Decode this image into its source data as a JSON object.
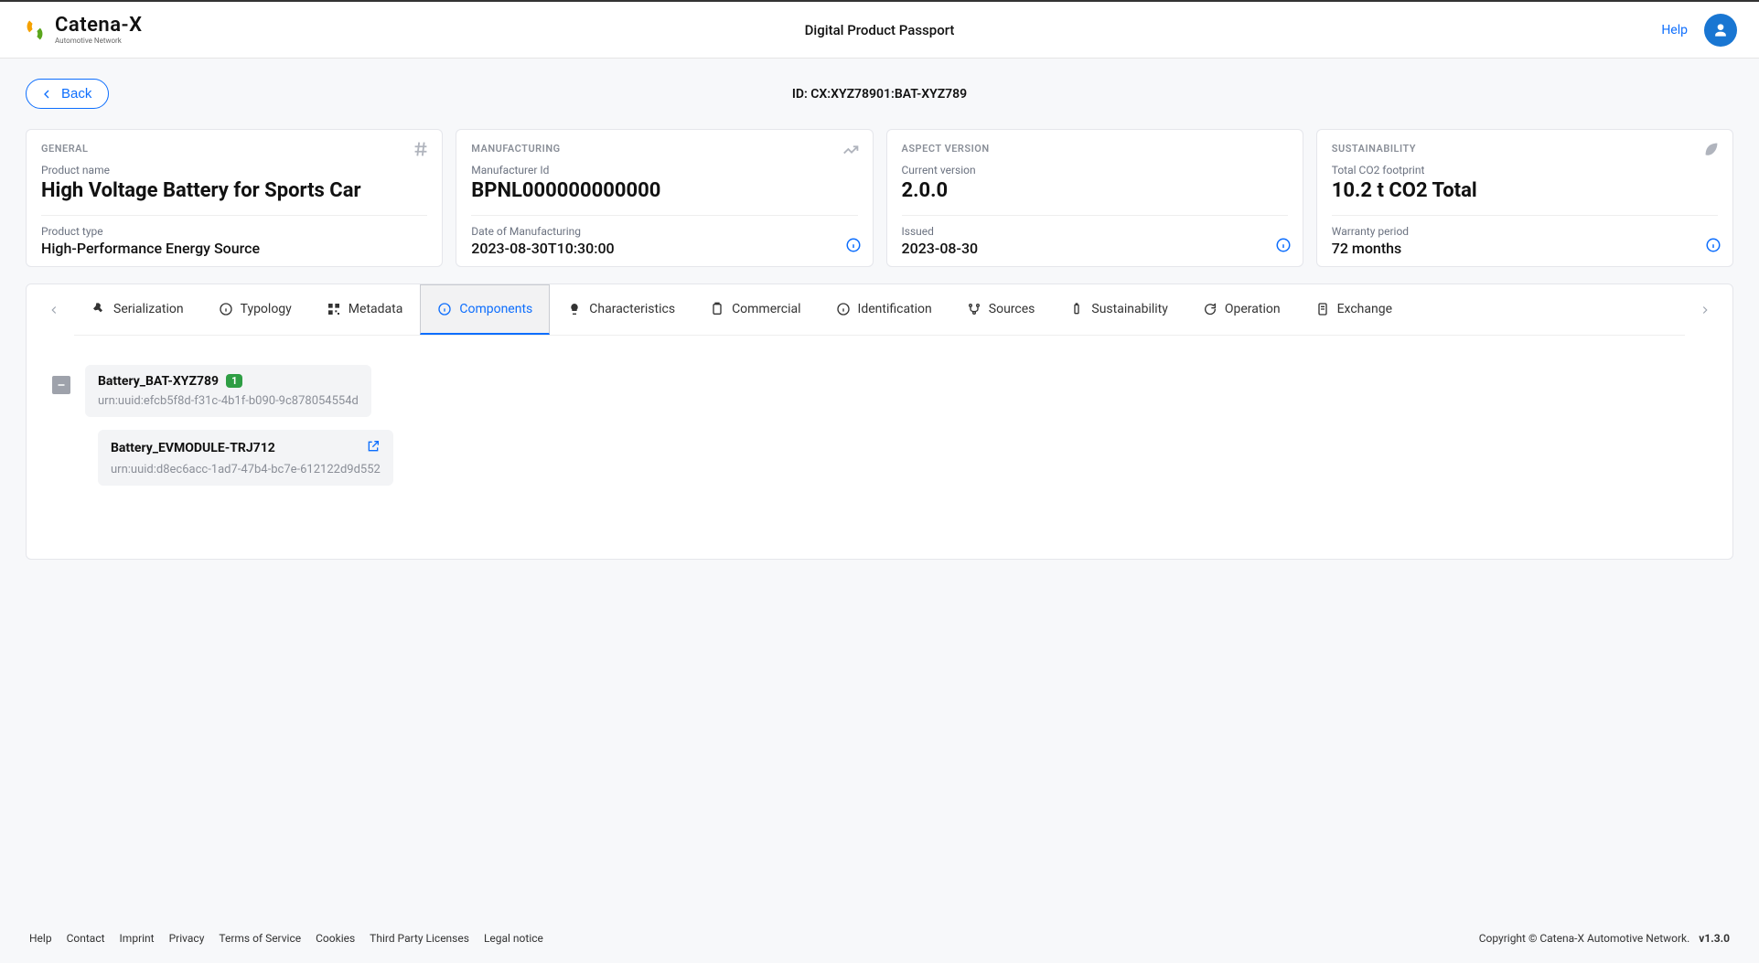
{
  "header": {
    "brand_name": "Catena-X",
    "brand_sub": "Automotive Network",
    "title": "Digital Product Passport",
    "help": "Help"
  },
  "page": {
    "back": "Back",
    "id_label": "ID: CX:XYZ78901:BAT-XYZ789"
  },
  "cards": {
    "general": {
      "category": "GENERAL",
      "name_label": "Product name",
      "name_value": "High Voltage Battery for Sports Car",
      "type_label": "Product type",
      "type_value": "High-Performance Energy Source"
    },
    "manufacturing": {
      "category": "MANUFACTURING",
      "id_label": "Manufacturer Id",
      "id_value": "BPNL000000000000",
      "date_label": "Date of Manufacturing",
      "date_value": "2023-08-30T10:30:00"
    },
    "aspect": {
      "category": "ASPECT VERSION",
      "cur_label": "Current version",
      "cur_value": "2.0.0",
      "issued_label": "Issued",
      "issued_value": "2023-08-30"
    },
    "sustainability": {
      "category": "SUSTAINABILITY",
      "co2_label": "Total CO2 footprint",
      "co2_value": "10.2 t CO2 Total",
      "warranty_label": "Warranty period",
      "warranty_value": "72 months"
    }
  },
  "tabs": [
    "Serialization",
    "Typology",
    "Metadata",
    "Components",
    "Characteristics",
    "Commercial",
    "Identification",
    "Sources",
    "Sustainability",
    "Operation",
    "Exchange"
  ],
  "tree": {
    "root": {
      "title": "Battery_BAT-XYZ789",
      "badge": "1",
      "urn": "urn:uuid:efcb5f8d-f31c-4b1f-b090-9c878054554d"
    },
    "child": {
      "title": "Battery_EVMODULE-TRJ712",
      "urn": "urn:uuid:d8ec6acc-1ad7-47b4-bc7e-612122d9d552"
    }
  },
  "footer": {
    "links": [
      "Help",
      "Contact",
      "Imprint",
      "Privacy",
      "Terms of Service",
      "Cookies",
      "Third Party Licenses",
      "Legal notice"
    ],
    "copyright": "Copyright © Catena-X Automotive Network.",
    "version": "v1.3.0"
  }
}
